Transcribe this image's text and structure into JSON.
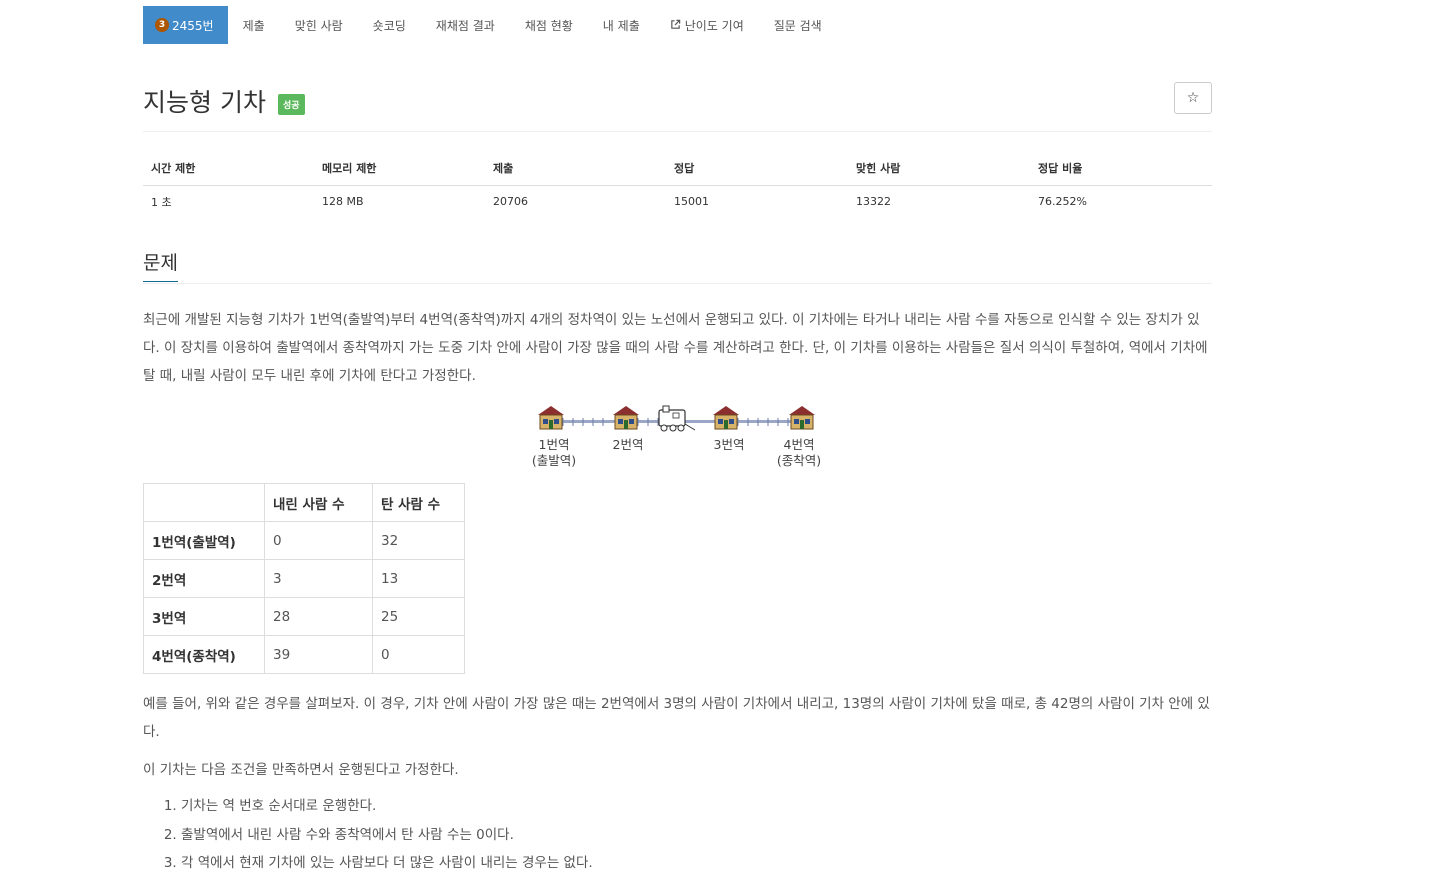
{
  "nav": {
    "problem": {
      "level": "3",
      "number": "2455번"
    },
    "items": [
      {
        "label": "제출"
      },
      {
        "label": "맞힌 사람"
      },
      {
        "label": "숏코딩"
      },
      {
        "label": "재채점 결과"
      },
      {
        "label": "채점 현황"
      },
      {
        "label": "내 제출"
      },
      {
        "label": "난이도 기여",
        "icon": "external-link-icon"
      },
      {
        "label": "질문 검색"
      }
    ]
  },
  "title": {
    "text": "지능형 기차",
    "badge": "성공",
    "star": "☆"
  },
  "colors": {
    "active": "#428bca",
    "success": "#5cb85c",
    "level": "#ad5600",
    "heading_underline": "#0d6b8f"
  },
  "info": {
    "headers": [
      "시간 제한",
      "메모리 제한",
      "제출",
      "정답",
      "맞힌 사람",
      "정답 비율"
    ],
    "values": [
      "1 초",
      "128 MB",
      "20706",
      "15001",
      "13322",
      "76.252%"
    ]
  },
  "section": {
    "heading": "문제"
  },
  "description": {
    "p1": "최근에 개발된 지능형 기차가 1번역(출발역)부터 4번역(종착역)까지 4개의 정차역이 있는 노선에서 운행되고 있다. 이 기차에는 타거나 내리는 사람 수를 자동으로 인식할 수 있는 장치가 있다. 이 장치를 이용하여 출발역에서 종착역까지 가는 도중 기차 안에 사람이 가장 많을 때의 사람 수를 계산하려고 한다. 단, 이 기차를 이용하는 사람들은 질서 의식이 투철하여, 역에서 기차에 탈 때, 내릴 사람이 모두 내린 후에 기차에 탄다고 가정한다.",
    "p2": "예를 들어, 위와 같은 경우를 살펴보자. 이 경우, 기차 안에 사람이 가장 많은 때는 2번역에서 3명의 사람이 기차에서 내리고, 13명의 사람이 기차에 탔을 때로, 총 42명의 사람이 기차 안에 있다.",
    "p3": "이 기차는 다음 조건을 만족하면서 운행된다고 가정한다.",
    "conditions": [
      "기차는 역 번호 순서대로 운행한다.",
      "출발역에서 내린 사람 수와 종착역에서 탄 사람 수는 0이다.",
      "각 역에서 현재 기차에 있는 사람보다 더 많은 사람이 내리는 경우는 없다."
    ]
  },
  "diagram": {
    "labels": [
      {
        "line1": "1번역",
        "line2": "(출발역)"
      },
      {
        "line1": "2번역",
        "line2": ""
      },
      {
        "line1": "3번역",
        "line2": ""
      },
      {
        "line1": "4번역",
        "line2": "(종착역)"
      }
    ]
  },
  "stations": {
    "headers": [
      "",
      "내린 사람 수",
      "탄 사람 수"
    ],
    "rows": [
      [
        "1번역(출발역)",
        "0",
        "32"
      ],
      [
        "2번역",
        "3",
        "13"
      ],
      [
        "3번역",
        "28",
        "25"
      ],
      [
        "4번역(종착역)",
        "39",
        "0"
      ]
    ]
  }
}
